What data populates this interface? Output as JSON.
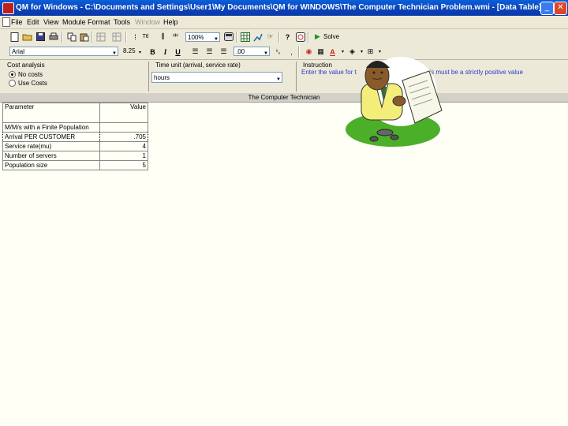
{
  "window": {
    "title": "QM for Windows - C:\\Documents and Settings\\User1\\My Documents\\QM for WINDOWS\\The Computer Technician Problem.wmi - [Data Table]",
    "minimize_label": "_",
    "restore_label": "▫",
    "close_label": "✕"
  },
  "menu": [
    "File",
    "Edit",
    "View",
    "Module",
    "Format",
    "Tools",
    "Window",
    "Help"
  ],
  "toolbar": {
    "zoom": "100%",
    "solve_label": "Solve",
    "font_name": "Arial",
    "font_size": "8.25",
    "decimals": ".00",
    "bold": "B",
    "italic": "I",
    "underline": "U"
  },
  "options": {
    "cost_analysis_label": "Cost analysis",
    "no_costs": "No costs",
    "use_costs": "Use Costs",
    "time_unit_label": "Time unit (arrival, service rate)",
    "time_unit_value": "hours",
    "instruction_label": "Instruction",
    "instruction_text": "Enter the value for t",
    "instruction_text_2": "This must be a strictly positive value"
  },
  "document_title": "The Computer Technician",
  "table": {
    "headers": [
      "Parameter",
      "Value"
    ],
    "rows": [
      {
        "param": "M/M/s with a Finite Population",
        "value": ""
      },
      {
        "param": "Arrival PER CUSTOMER",
        "value": ".705"
      },
      {
        "param": "Service rate(mu)",
        "value": "4"
      },
      {
        "param": "Number of servers",
        "value": "1"
      },
      {
        "param": "Population size",
        "value": "5"
      }
    ]
  }
}
